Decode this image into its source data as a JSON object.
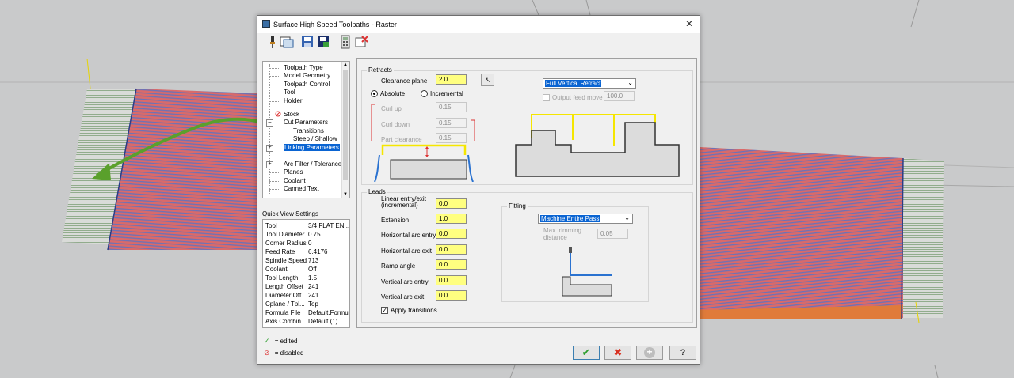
{
  "window": {
    "title": "Surface High Speed Toolpaths - Raster",
    "close": "✕"
  },
  "toolbar": {
    "icons": [
      "tool-icon",
      "view-icon",
      "save-icon",
      "save-as-icon",
      "calculator-icon",
      "delete-icon"
    ]
  },
  "tree": {
    "items": [
      {
        "label": "Toolpath Type"
      },
      {
        "label": "Model Geometry"
      },
      {
        "label": "Toolpath Control"
      },
      {
        "label": "Tool"
      },
      {
        "label": "Holder"
      },
      {
        "label": "Stock"
      },
      {
        "label": "Cut Parameters"
      },
      {
        "label": "Transitions"
      },
      {
        "label": "Steep / Shallow"
      },
      {
        "label": "Linking Parameters"
      },
      {
        "label": "Arc Filter / Tolerance"
      },
      {
        "label": "Planes"
      },
      {
        "label": "Coolant"
      },
      {
        "label": "Canned Text"
      }
    ],
    "selected": "Linking Parameters"
  },
  "quick_view": {
    "title": "Quick View Settings",
    "rows": [
      {
        "key": "Tool",
        "value": "3/4 FLAT EN..."
      },
      {
        "key": "Tool Diameter",
        "value": "0.75"
      },
      {
        "key": "Corner Radius",
        "value": "0"
      },
      {
        "key": "Feed Rate",
        "value": "6.4176"
      },
      {
        "key": "Spindle Speed",
        "value": "713"
      },
      {
        "key": "Coolant",
        "value": "Off"
      },
      {
        "key": "Tool Length",
        "value": "1.5"
      },
      {
        "key": "Length Offset",
        "value": "241"
      },
      {
        "key": "Diameter Off...",
        "value": "241"
      },
      {
        "key": "Cplane / Tpl...",
        "value": "Top"
      },
      {
        "key": "Formula File",
        "value": "Default.Formula"
      },
      {
        "key": "Axis Combin...",
        "value": "Default (1)"
      }
    ]
  },
  "legend": {
    "edited": "= edited",
    "disabled": "= disabled"
  },
  "retracts": {
    "title": "Retracts",
    "clearance_label": "Clearance plane",
    "clearance_value": "2.0",
    "absolute_label": "Absolute",
    "incremental_label": "Incremental",
    "mode": "Absolute",
    "curl_up_label": "Curl up",
    "curl_up_value": "0.15",
    "curl_down_label": "Curl down",
    "curl_down_value": "0.15",
    "part_clearance_label": "Part clearance",
    "part_clearance_value": "0.15",
    "retract_type": "Full Vertical Retract",
    "output_feed_label": "Output feed move",
    "output_feed_value": "100.0",
    "output_feed_checked": false
  },
  "leads": {
    "title": "Leads",
    "fields": [
      {
        "label": "Linear entry/exit (incremental)",
        "value": "0.0"
      },
      {
        "label": "Extension",
        "value": "1.0"
      },
      {
        "label": "Horizontal arc entry",
        "value": "0.0"
      },
      {
        "label": "Horizontal arc exit",
        "value": "0.0"
      },
      {
        "label": "Ramp angle",
        "value": "0.0"
      },
      {
        "label": "Vertical arc entry",
        "value": "0.0"
      },
      {
        "label": "Vertical arc exit",
        "value": "0.0"
      }
    ],
    "apply_transitions_label": "Apply transitions",
    "apply_transitions_checked": true
  },
  "fitting": {
    "title": "Fitting",
    "mode": "Machine Entire Pass",
    "max_trim_label": "Max trimming distance",
    "max_trim_value": "0.05"
  },
  "buttons": {
    "ok": "✔",
    "cancel": "✖",
    "add": "+",
    "help": "?"
  },
  "colors": {
    "highlight": "#0a64d2",
    "field_yellow": "#ffff80",
    "arrow_green": "#5aa02c",
    "retract_yellow": "#f5e600",
    "ok_green": "#2e9e2e",
    "cancel_red": "#d83020"
  }
}
